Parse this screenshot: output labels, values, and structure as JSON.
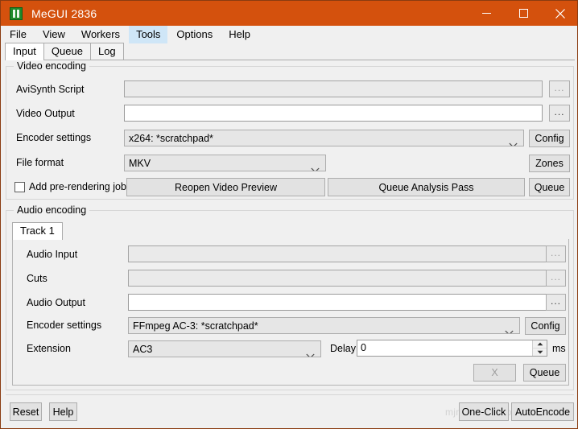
{
  "window": {
    "title": "MeGUI 2836",
    "icon": "megui-app-icon",
    "controls": {
      "minimize": "minimize-icon",
      "maximize": "maximize-icon",
      "close": "close-icon"
    },
    "titlebar_color": "#d4510d",
    "border_color": "#8a3b10"
  },
  "menubar": {
    "items": [
      {
        "label": "File",
        "highlighted": false
      },
      {
        "label": "View",
        "highlighted": false
      },
      {
        "label": "Workers",
        "highlighted": false
      },
      {
        "label": "Tools",
        "highlighted": true
      },
      {
        "label": "Options",
        "highlighted": false
      },
      {
        "label": "Help",
        "highlighted": false
      }
    ],
    "highlight_color": "#cfe6f7"
  },
  "tabs": {
    "items": [
      {
        "label": "Input",
        "active": true
      },
      {
        "label": "Queue",
        "active": false
      },
      {
        "label": "Log",
        "active": false
      }
    ]
  },
  "video_encoding": {
    "group_label": "Video encoding",
    "avisynth_script": {
      "label": "AviSynth Script",
      "value": "",
      "disabled": true,
      "browse_label": "..."
    },
    "video_output": {
      "label": "Video Output",
      "value": "",
      "disabled": false,
      "browse_label": "..."
    },
    "encoder_settings": {
      "label": "Encoder settings",
      "value": "x264: *scratchpad*",
      "config_label": "Config"
    },
    "file_format": {
      "label": "File format",
      "value": "MKV",
      "zones_label": "Zones"
    },
    "pre_rendering": {
      "label": "Add pre-rendering job",
      "checked": false
    },
    "reopen_preview_label": "Reopen Video Preview",
    "queue_analysis_label": "Queue Analysis Pass",
    "queue_label": "Queue"
  },
  "audio_encoding": {
    "group_label": "Audio encoding",
    "track_tab": "Track 1",
    "audio_input": {
      "label": "Audio Input",
      "value": "",
      "disabled": true,
      "browse_label": "..."
    },
    "cuts": {
      "label": "Cuts",
      "value": "",
      "disabled": true,
      "browse_label": "..."
    },
    "audio_output": {
      "label": "Audio Output",
      "value": "",
      "disabled": false,
      "browse_label": "..."
    },
    "encoder_settings": {
      "label": "Encoder settings",
      "value": "FFmpeg AC-3: *scratchpad*",
      "config_label": "Config"
    },
    "extension": {
      "label": "Extension",
      "value": "AC3"
    },
    "delay": {
      "label": "Delay",
      "value": "0",
      "unit": "ms"
    },
    "remove_label": "X",
    "queue_label": "Queue"
  },
  "bottom_bar": {
    "reset_label": "Reset",
    "help_label": "Help",
    "one_click_label": "One-Click",
    "auto_encode_label": "AutoEncode",
    "ghost_text": "mjm megui tools"
  }
}
